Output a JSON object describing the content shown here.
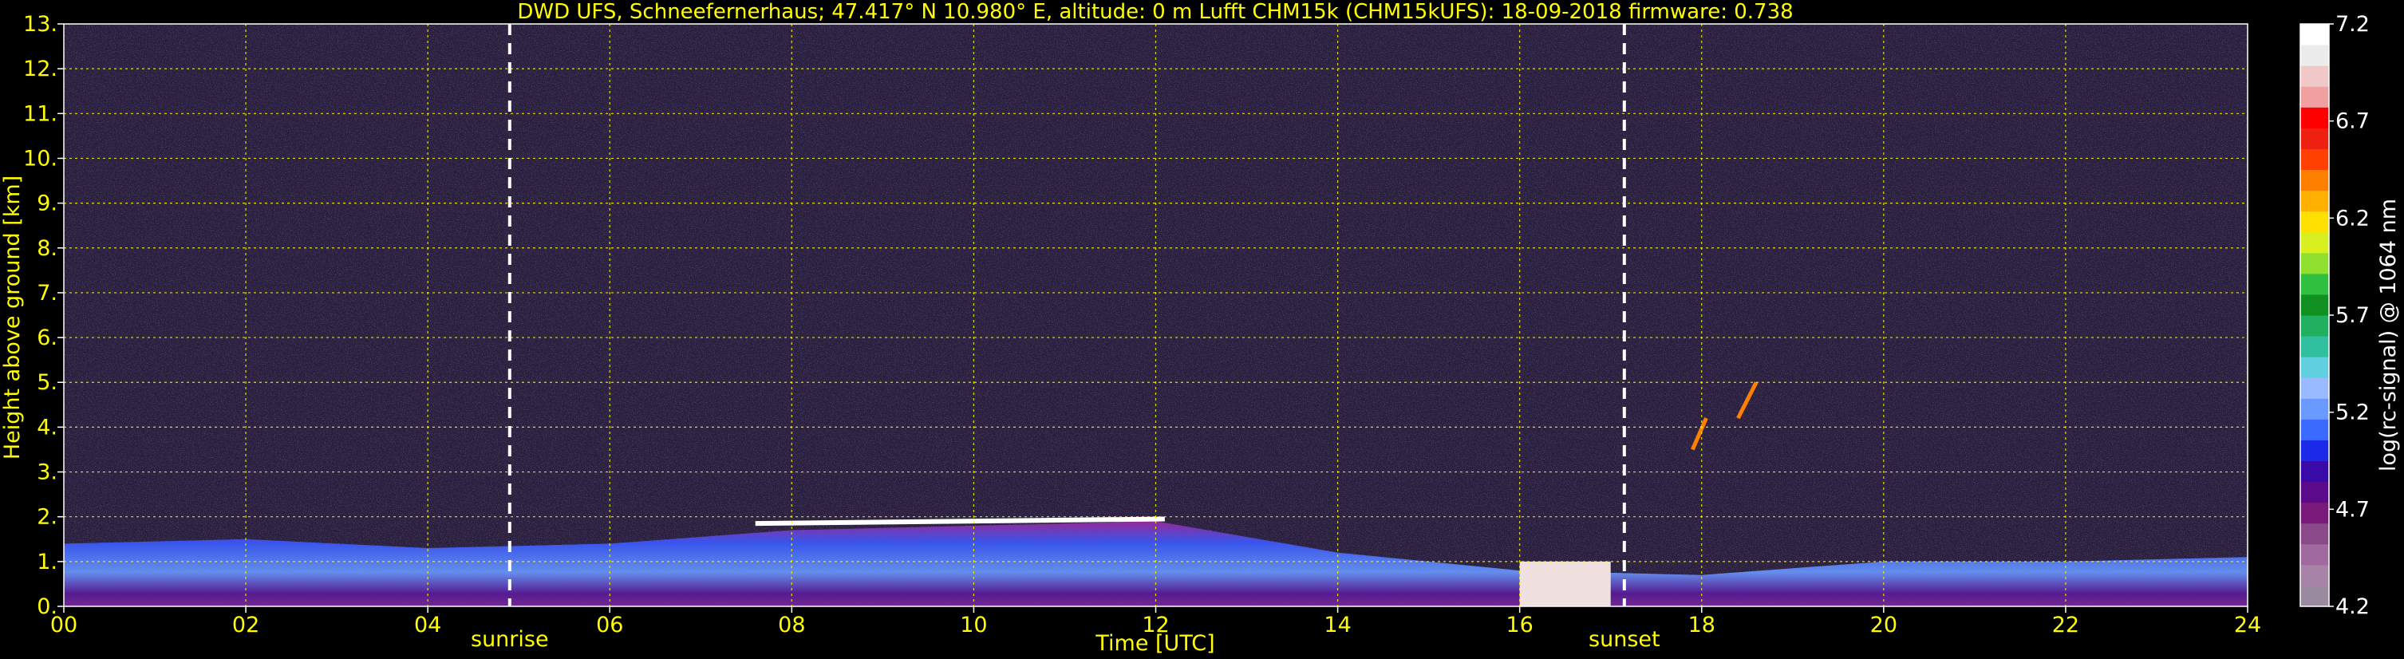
{
  "header": {
    "title": "DWD UFS, Schneefernerhaus; 47.417° N 10.980° E, altitude: 0 m    Lufft CHM15k (CHM15kUFS): 18-09-2018    firmware: 0.738"
  },
  "annotations": {
    "sunrise_label": "sunrise",
    "sunset_label": "sunset",
    "sunrise_hour": 4.9,
    "sunset_hour": 17.15
  },
  "colorbar": {
    "label": "log(rc-signal) @ 1064 nm",
    "ticks": [
      "7.2",
      "6.7",
      "6.2",
      "5.7",
      "5.2",
      "4.7",
      "4.2"
    ],
    "min": 4.2,
    "max": 7.2,
    "colors": [
      "#9a8aa0",
      "#a883a8",
      "#a06aa0",
      "#8a4a8a",
      "#7a1a7a",
      "#5a0a8a",
      "#3a0aa8",
      "#1a2ae8",
      "#3a6aff",
      "#6a9aff",
      "#9abaff",
      "#60d0e0",
      "#30c0a0",
      "#20b060",
      "#109020",
      "#30c040",
      "#90e030",
      "#d8f020",
      "#ffe000",
      "#ffb000",
      "#ff8000",
      "#ff4000",
      "#ee2010",
      "#ff0000",
      "#f0a0a0",
      "#f0c8c8",
      "#ececec",
      "#ffffff"
    ]
  },
  "chart_data": {
    "type": "heatmap",
    "title": "DWD UFS, Schneefernerhaus; 47.417° N 10.980° E, altitude: 0 m    Lufft CHM15k (CHM15kUFS): 18-09-2018    firmware: 0.738",
    "xlabel": "Time [UTC]",
    "ylabel": "Height above ground [km]",
    "xlim": [
      0,
      24
    ],
    "ylim": [
      0,
      13
    ],
    "xticks": [
      "00",
      "02",
      "04",
      "06",
      "08",
      "10",
      "12",
      "14",
      "16",
      "18",
      "20",
      "22",
      "24"
    ],
    "yticks": [
      "0.",
      "1.",
      "2.",
      "3.",
      "4.",
      "5.",
      "6.",
      "7.",
      "8.",
      "9.",
      "10.",
      "11.",
      "12.",
      "13."
    ],
    "grid": true,
    "colorbar_label": "log(rc-signal) @ 1064 nm",
    "color_range": [
      4.2,
      7.2
    ],
    "features": [
      {
        "name": "boundary layer",
        "x": [
          0,
          24
        ],
        "y_top": [
          1.4,
          1.5,
          1.3,
          1.4,
          1.7,
          1.8,
          1.9,
          1.2,
          0.8,
          0.7,
          1.0,
          1.0,
          1.1
        ]
      },
      {
        "name": "layer top 2 km",
        "x": [
          7.6,
          12.1
        ],
        "y": 1.85
      },
      {
        "name": "cloud tops",
        "x": [
          17.9,
          18.6
        ],
        "y": [
          3.5,
          5.0
        ]
      }
    ]
  }
}
